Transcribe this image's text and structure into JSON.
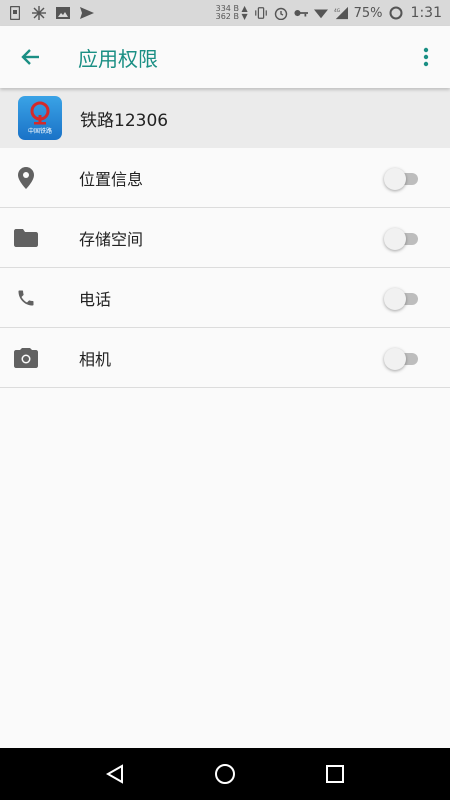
{
  "status_bar": {
    "net_up": "334 B",
    "net_down": "362 B",
    "battery": "75%",
    "time": "1:31",
    "icons": [
      "sim-icon",
      "snowflake-icon",
      "image-icon",
      "send-icon",
      "vibrate-icon",
      "alarm-icon",
      "key-icon",
      "wifi-icon",
      "signal-4g-icon",
      "battery-icon"
    ]
  },
  "app_bar": {
    "title": "应用权限",
    "back_icon": "arrow-back-icon",
    "more_icon": "more-vert-icon"
  },
  "app": {
    "name": "铁路12306",
    "icon_caption": "中国铁路"
  },
  "permissions": [
    {
      "label": "位置信息",
      "icon": "location-pin-icon",
      "enabled": false
    },
    {
      "label": "存储空间",
      "icon": "folder-icon",
      "enabled": false
    },
    {
      "label": "电话",
      "icon": "phone-icon",
      "enabled": false
    },
    {
      "label": "相机",
      "icon": "camera-icon",
      "enabled": false
    }
  ],
  "colors": {
    "accent": "#1a8f84",
    "icon_gray": "#616161"
  }
}
